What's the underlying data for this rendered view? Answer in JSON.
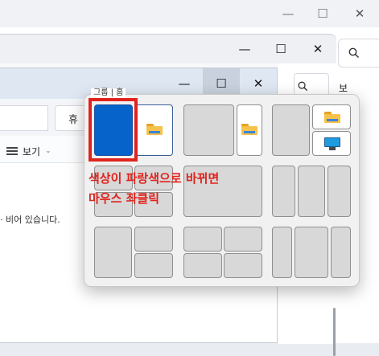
{
  "windows": {
    "back": {
      "controls": [
        "—",
        "☐",
        "✕"
      ]
    },
    "middle": {
      "controls": [
        "—",
        "☐",
        "✕"
      ],
      "side_label": "보기"
    },
    "front": {
      "controls": [
        "—",
        "☐",
        "✕"
      ],
      "ghost_button": "휴",
      "view_button": "보기",
      "empty_message": "· 비어 있습니다."
    }
  },
  "snap_layouts": {
    "tooltip": "그룹 | 홈",
    "layouts": [
      {
        "name": "two-halves",
        "zones": 2,
        "selected_zone": 1
      },
      {
        "name": "wide-left-narrow-right",
        "zones": 2
      },
      {
        "name": "left-and-two-stacked",
        "zones": 3
      },
      {
        "name": "four-quadrants",
        "zones": 4
      },
      {
        "name": "three-columns",
        "zones": 3
      },
      {
        "name": "wide-center-three",
        "zones": 3
      },
      {
        "name": "left-and-stacked-right",
        "zones": 3
      },
      {
        "name": "two-by-two-grid",
        "zones": 4
      },
      {
        "name": "three-columns-wide-center",
        "zones": 3
      }
    ]
  },
  "annotation": {
    "line1": "색상이 파랑색으로 바뀌면",
    "line2": "마우스 좌클릭",
    "color": "#e1231d"
  },
  "colors": {
    "selected_zone": "#0563c9",
    "folder": "#f7c24a",
    "monitor": "#1f9be0"
  }
}
